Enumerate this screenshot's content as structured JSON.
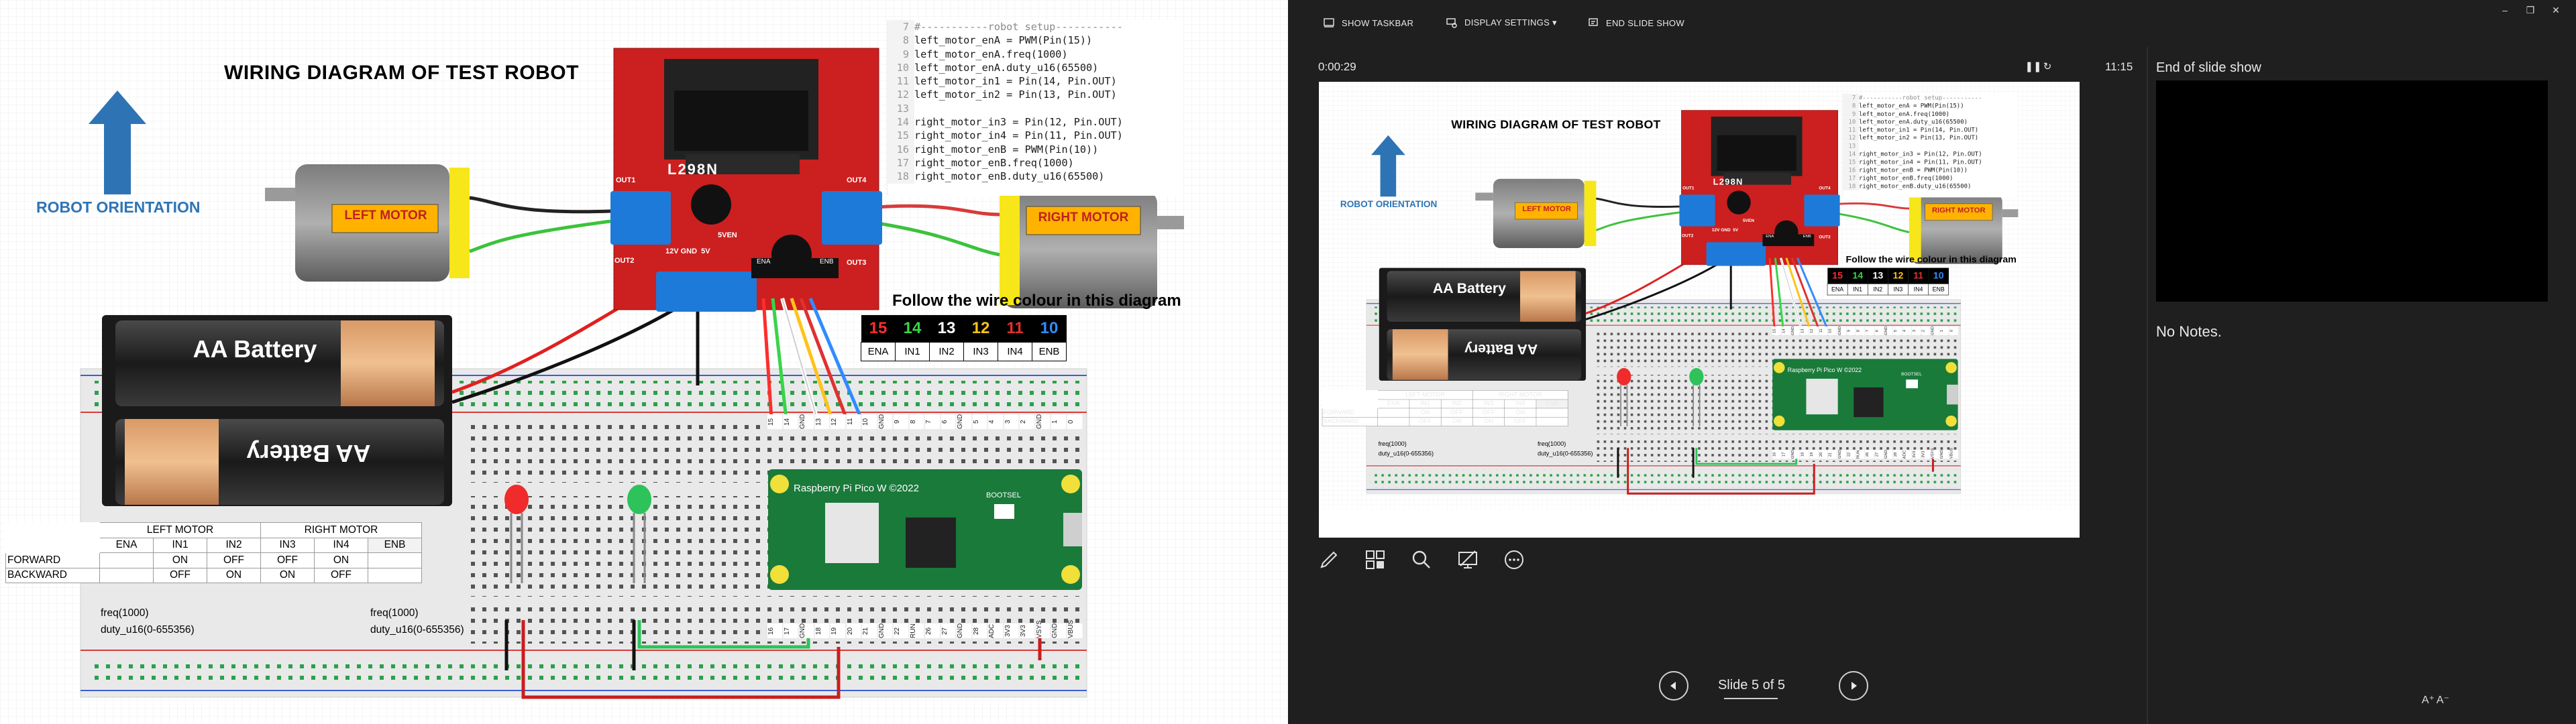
{
  "slide": {
    "title": "WIRING DIAGRAM OF TEST ROBOT",
    "orientation_label": "ROBOT ORIENTATION",
    "left_motor_label": "LEFT MOTOR",
    "right_motor_label": "RIGHT MOTOR",
    "battery_label": "AA Battery",
    "driver_label": "L298N",
    "driver_terminals": {
      "out1": "OUT1",
      "out2": "OUT2",
      "out3": "OUT3",
      "out4": "OUT4",
      "power": "12V GND  5V",
      "sen": "5VEN",
      "ena": "ENA",
      "enb": "ENB"
    },
    "pico_label": "Raspberry Pi Pico W ©2022",
    "pico_bootsel": "BOOTSEL",
    "follow_text": "Follow the wire colour in this diagram",
    "wire_pins": [
      {
        "pin": "15",
        "label": "ENA",
        "color": "#ff2d2d"
      },
      {
        "pin": "14",
        "label": "IN1",
        "color": "#38d44a"
      },
      {
        "pin": "13",
        "label": "IN2",
        "color": "#ffffff"
      },
      {
        "pin": "12",
        "label": "IN3",
        "color": "#ffc21a"
      },
      {
        "pin": "11",
        "label": "IN4",
        "color": "#e03030"
      },
      {
        "pin": "10",
        "label": "ENB",
        "color": "#2f8cff"
      }
    ],
    "code_lines": [
      {
        "num": "7",
        "text": "#-----------robot setup-----------"
      },
      {
        "num": "8",
        "text": "left_motor_enA = PWM(Pin(15))"
      },
      {
        "num": "9",
        "text": "left_motor_enA.freq(1000)"
      },
      {
        "num": "10",
        "text": "left_motor_enA.duty_u16(65500)"
      },
      {
        "num": "11",
        "text": "left_motor_in1 = Pin(14, Pin.OUT)"
      },
      {
        "num": "12",
        "text": "left_motor_in2 = Pin(13, Pin.OUT)"
      },
      {
        "num": "13",
        "text": ""
      },
      {
        "num": "14",
        "text": "right_motor_in3 = Pin(12, Pin.OUT)"
      },
      {
        "num": "15",
        "text": "right_motor_in4 = Pin(11, Pin.OUT)"
      },
      {
        "num": "16",
        "text": "right_motor_enB = PWM(Pin(10))"
      },
      {
        "num": "17",
        "text": "right_motor_enB.freq(1000)"
      },
      {
        "num": "18",
        "text": "right_motor_enB.duty_u16(65500)"
      }
    ],
    "logic_table": {
      "group_left": "LEFT MOTOR",
      "group_right": "RIGHT MOTOR",
      "headers": [
        "ENA",
        "IN1",
        "IN2",
        "IN3",
        "IN4",
        "ENB"
      ],
      "rows": [
        {
          "label": "FORWARD",
          "cells": [
            "",
            "ON",
            "OFF",
            "OFF",
            "ON",
            ""
          ]
        },
        {
          "label": "BACKWARD",
          "cells": [
            "",
            "OFF",
            "ON",
            "ON",
            "OFF",
            ""
          ]
        }
      ],
      "freq_left": "freq(1000)",
      "duty_left": "duty_u16(0-655356)",
      "freq_right": "freq(1000)",
      "duty_right": "duty_u16(0-655356)"
    },
    "pico_top_pins": [
      "15",
      "14",
      "GND",
      "13",
      "12",
      "11",
      "10",
      "GND",
      "9",
      "8",
      "7",
      "6",
      "GND",
      "5",
      "4",
      "3",
      "2",
      "GND",
      "1",
      "0"
    ],
    "pico_bottom_pins": [
      "16",
      "17",
      "GND",
      "18",
      "19",
      "20",
      "21",
      "GND",
      "22",
      "RUN",
      "26",
      "27",
      "GND",
      "28",
      "ADC",
      "3V3",
      "3V3",
      "VSYS",
      "GND",
      "VBUS"
    ]
  },
  "presenter": {
    "toolbar": {
      "show_taskbar": "SHOW TASKBAR",
      "display_settings": "DISPLAY SETTINGS ▾",
      "end_slide_show": "END SLIDE SHOW"
    },
    "timer": "0:00:29",
    "clock": "11:15",
    "next_label": "End of slide show",
    "notes": "No Notes.",
    "slide_counter": "Slide 5 of 5",
    "font_increase": "A⁺",
    "font_decrease": "A⁻"
  },
  "colors": {
    "presenter_bg": "#1f1f1f",
    "title_blue": "#2e74b5",
    "driver_red": "#cc1f1f",
    "pico_green": "#1a7a3a"
  }
}
